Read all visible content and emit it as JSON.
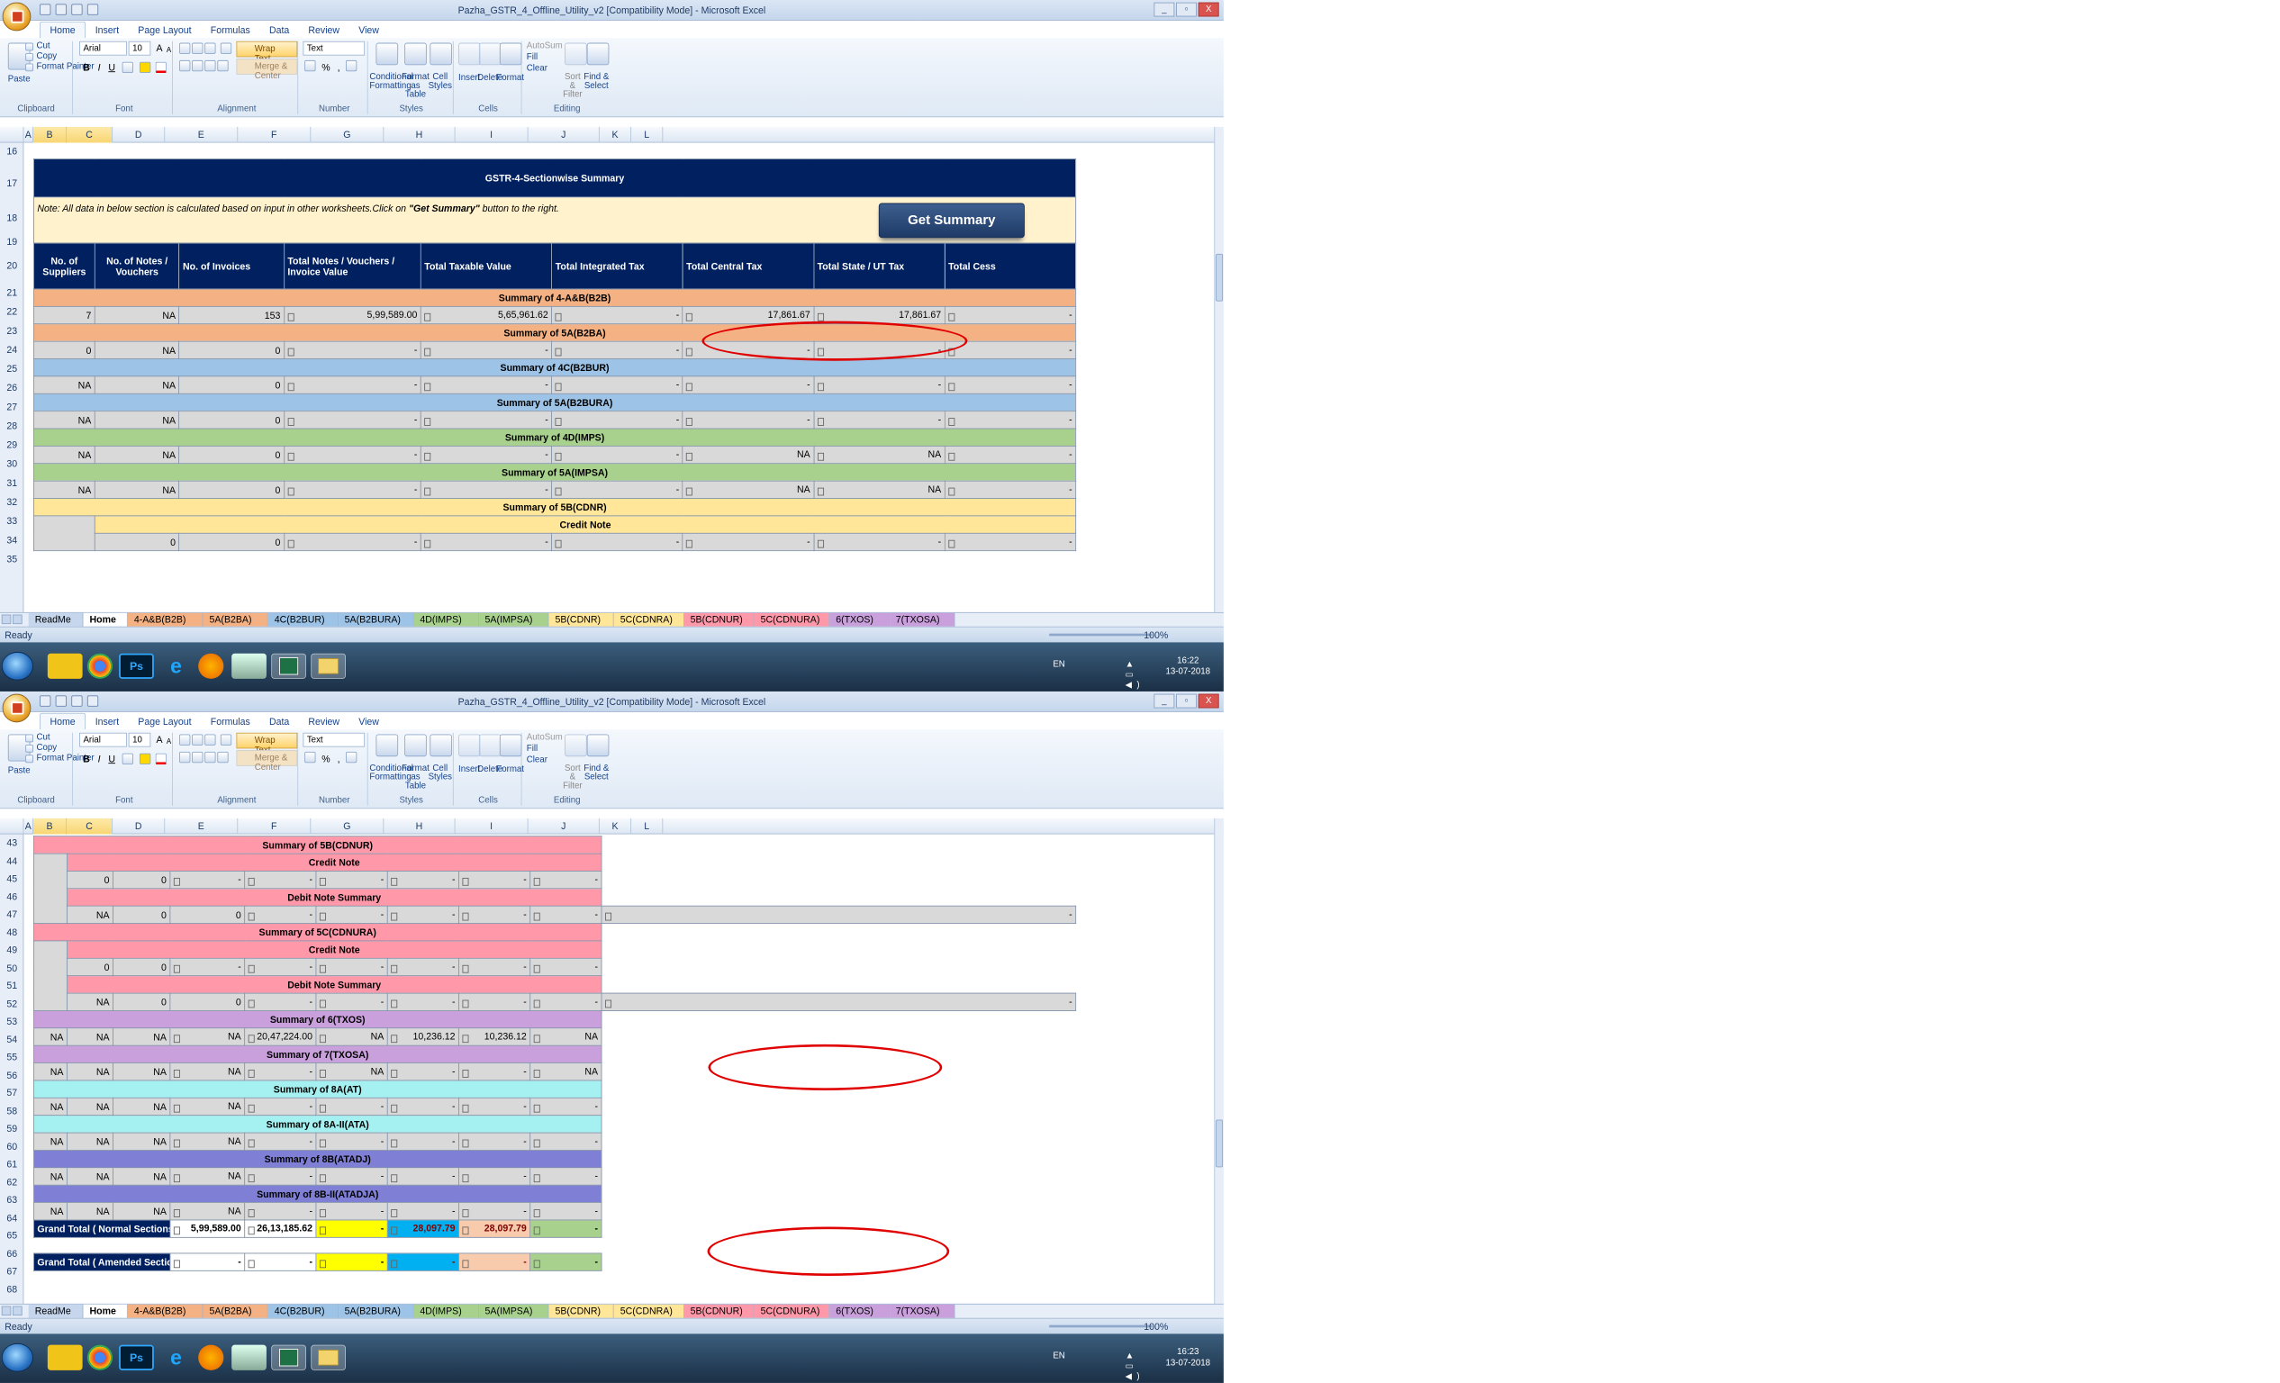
{
  "window": {
    "title": "Pazha_GSTR_4_Offline_Utility_v2  [Compatibility Mode] - Microsoft Excel",
    "controls": [
      "?",
      "_",
      "▫",
      "X"
    ]
  },
  "ribbon": {
    "tabs": [
      "Home",
      "Insert",
      "Page Layout",
      "Formulas",
      "Data",
      "Review",
      "View"
    ],
    "clipboard": {
      "paste": "Paste",
      "cut": "Cut",
      "copy": "Copy",
      "format_painter": "Format Painter",
      "label": "Clipboard"
    },
    "font": {
      "name": "Arial",
      "size": "10",
      "label": "Font",
      "bold": "B",
      "italic": "I",
      "underline": "U",
      "grow": "A",
      "shrink": "A"
    },
    "alignment": {
      "wrap_text": "Wrap Text",
      "merge_center": "Merge & Center",
      "label": "Alignment"
    },
    "number": {
      "format": "Text",
      "percent": "%",
      "comma": ",",
      "label": "Number"
    },
    "styles": {
      "conditional": "Conditional Formatting",
      "format_table": "Format as Table",
      "cell_styles": "Cell Styles",
      "label": "Styles"
    },
    "cells": {
      "insert": "Insert",
      "delete": "Delete",
      "format": "Format",
      "label": "Cells"
    },
    "editing": {
      "autosum": "AutoSum",
      "fill": "Fill",
      "clear": "Clear",
      "sort_filter": "Sort & Filter",
      "find_select": "Find & Select",
      "label": "Editing"
    }
  },
  "columns": [
    "A",
    "B",
    "C",
    "D",
    "E",
    "F",
    "G",
    "H",
    "I",
    "J",
    "K",
    "L"
  ],
  "summary": {
    "title": "GSTR-4-Sectionwise Summary",
    "note_prefix": "Note: All data in below section is calculated based on input in other worksheets.Click on ",
    "note_button_ref": "\"Get Summary\"",
    "note_suffix": " button to the right.",
    "button": "Get Summary",
    "headers": [
      "No. of Suppliers",
      "No. of Notes / Vouchers",
      "No. of Invoices",
      "Total Notes /  Vouchers / Invoice Value",
      "Total Taxable Value",
      "Total Integrated Tax",
      "Total Central Tax",
      "Total State / UT Tax",
      "Total Cess"
    ]
  },
  "sections1": [
    {
      "title": "Summary of 4-A&B(B2B)",
      "row": [
        "7",
        "NA",
        "153",
        "5,99,589.00",
        "5,65,961.62",
        "-",
        "17,861.67",
        "17,861.67",
        "-"
      ]
    },
    {
      "title": "Summary of 5A(B2BA)",
      "row": [
        "0",
        "NA",
        "0",
        "-",
        "-",
        "-",
        "-",
        "-",
        "-"
      ]
    },
    {
      "title": "Summary of 4C(B2BUR)",
      "row": [
        "NA",
        "NA",
        "0",
        "-",
        "-",
        "-",
        "-",
        "-",
        "-"
      ]
    },
    {
      "title": "Summary of 5A(B2BURA)",
      "row": [
        "NA",
        "NA",
        "0",
        "-",
        "-",
        "-",
        "-",
        "-",
        "-"
      ]
    },
    {
      "title": "Summary of 4D(IMPS)",
      "row": [
        "NA",
        "NA",
        "0",
        "-",
        "-",
        "-",
        "NA",
        "NA",
        "-"
      ]
    },
    {
      "title": "Summary of 5A(IMPSA)",
      "row": [
        "NA",
        "NA",
        "0",
        "-",
        "-",
        "-",
        "NA",
        "NA",
        "-"
      ]
    },
    {
      "title": "Summary of 5B(CDNR)",
      "sub": "Credit Note",
      "row": [
        "",
        "0",
        "0",
        "-",
        "-",
        "-",
        "-",
        "-",
        "-"
      ]
    }
  ],
  "sections2": [
    {
      "title": "Summary of 5B(CDNUR)",
      "sub1": "Credit Note",
      "row1": [
        "",
        "0",
        "0",
        "-",
        "-",
        "-",
        "-",
        "-",
        "-"
      ],
      "sub2": "Debit Note Summary",
      "row2": [
        "NA",
        "0",
        "0",
        "-",
        "-",
        "-",
        "-",
        "-",
        "-"
      ]
    },
    {
      "title": "Summary of 5C(CDNURA)",
      "sub1": "Credit Note",
      "row1": [
        "",
        "0",
        "0",
        "-",
        "-",
        "-",
        "-",
        "-",
        "-"
      ],
      "sub2": "Debit Note Summary",
      "row2": [
        "NA",
        "0",
        "0",
        "-",
        "-",
        "-",
        "-",
        "-",
        "-"
      ]
    },
    {
      "title": "Summary of 6(TXOS)",
      "row": [
        "NA",
        "NA",
        "NA",
        "NA",
        "20,47,224.00",
        "NA",
        "10,236.12",
        "10,236.12",
        "NA"
      ]
    },
    {
      "title": "Summary of 7(TXOSA)",
      "row": [
        "NA",
        "NA",
        "NA",
        "NA",
        "-",
        "NA",
        "-",
        "-",
        "NA"
      ]
    },
    {
      "title": "Summary of 8A(AT)",
      "row": [
        "NA",
        "NA",
        "NA",
        "NA",
        "-",
        "-",
        "-",
        "-",
        "-"
      ]
    },
    {
      "title": "Summary of 8A-II(ATA)",
      "row": [
        "NA",
        "NA",
        "NA",
        "NA",
        "-",
        "-",
        "-",
        "-",
        "-"
      ]
    },
    {
      "title": "Summary of 8B(ATADJ)",
      "row": [
        "NA",
        "NA",
        "NA",
        "NA",
        "-",
        "-",
        "-",
        "-",
        "-"
      ]
    },
    {
      "title": "Summary of 8B-II(ATADJA)",
      "row": [
        "NA",
        "NA",
        "NA",
        "NA",
        "-",
        "-",
        "-",
        "-",
        "-"
      ]
    }
  ],
  "grand_total_normal": {
    "label": "Grand Total ( Normal Sections )",
    "invoice_value": "5,99,589.00",
    "taxable": "26,13,185.62",
    "integrated": "-",
    "central": "28,097.79",
    "state": "28,097.79",
    "cess": "-"
  },
  "grand_total_amended": {
    "label": "Grand Total ( Amended Sections )",
    "invoice_value": "-",
    "taxable": "-",
    "integrated": "-",
    "central": "-",
    "state": "-",
    "cess": "-"
  },
  "sheet_tabs": [
    "ReadMe",
    "Home",
    "4-A&B(B2B)",
    "5A(B2BA)",
    "4C(B2BUR)",
    "5A(B2BURA)",
    "4D(IMPS)",
    "5A(IMPSA)",
    "5B(CDNR)",
    "5C(CDNRA)",
    "5B(CDNUR)",
    "5C(CDNURA)",
    "6(TXOS)",
    "7(TXOSA)"
  ],
  "status": {
    "ready": "Ready",
    "zoom": "100%"
  },
  "taskbar": {
    "lang": "EN",
    "time1": "16:22",
    "time2": "16:23",
    "date": "13-07-2018",
    "ps": "Ps"
  },
  "colors": {
    "header_navy": "#002060",
    "circle_red": "#e00000"
  }
}
